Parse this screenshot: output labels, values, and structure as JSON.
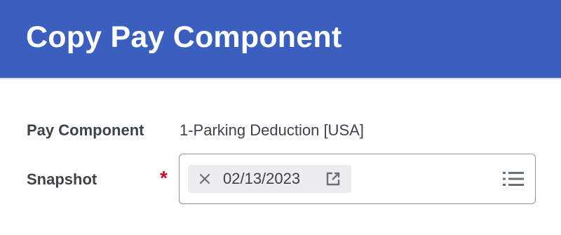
{
  "header": {
    "title": "Copy Pay Component",
    "background_color": "#3a5fbe"
  },
  "form": {
    "pay_component": {
      "label": "Pay Component",
      "value": "1-Parking Deduction [USA]"
    },
    "snapshot": {
      "label": "Snapshot",
      "required_marker": "*",
      "selected_value": "02/13/2023",
      "remove_icon": "close-icon",
      "open_icon": "open-related-icon",
      "prompt_icon": "list-icon"
    }
  },
  "colors": {
    "label_text": "#3d434b",
    "required": "#c8102e",
    "pill_background": "#ebedef",
    "field_border": "#8e949c"
  }
}
